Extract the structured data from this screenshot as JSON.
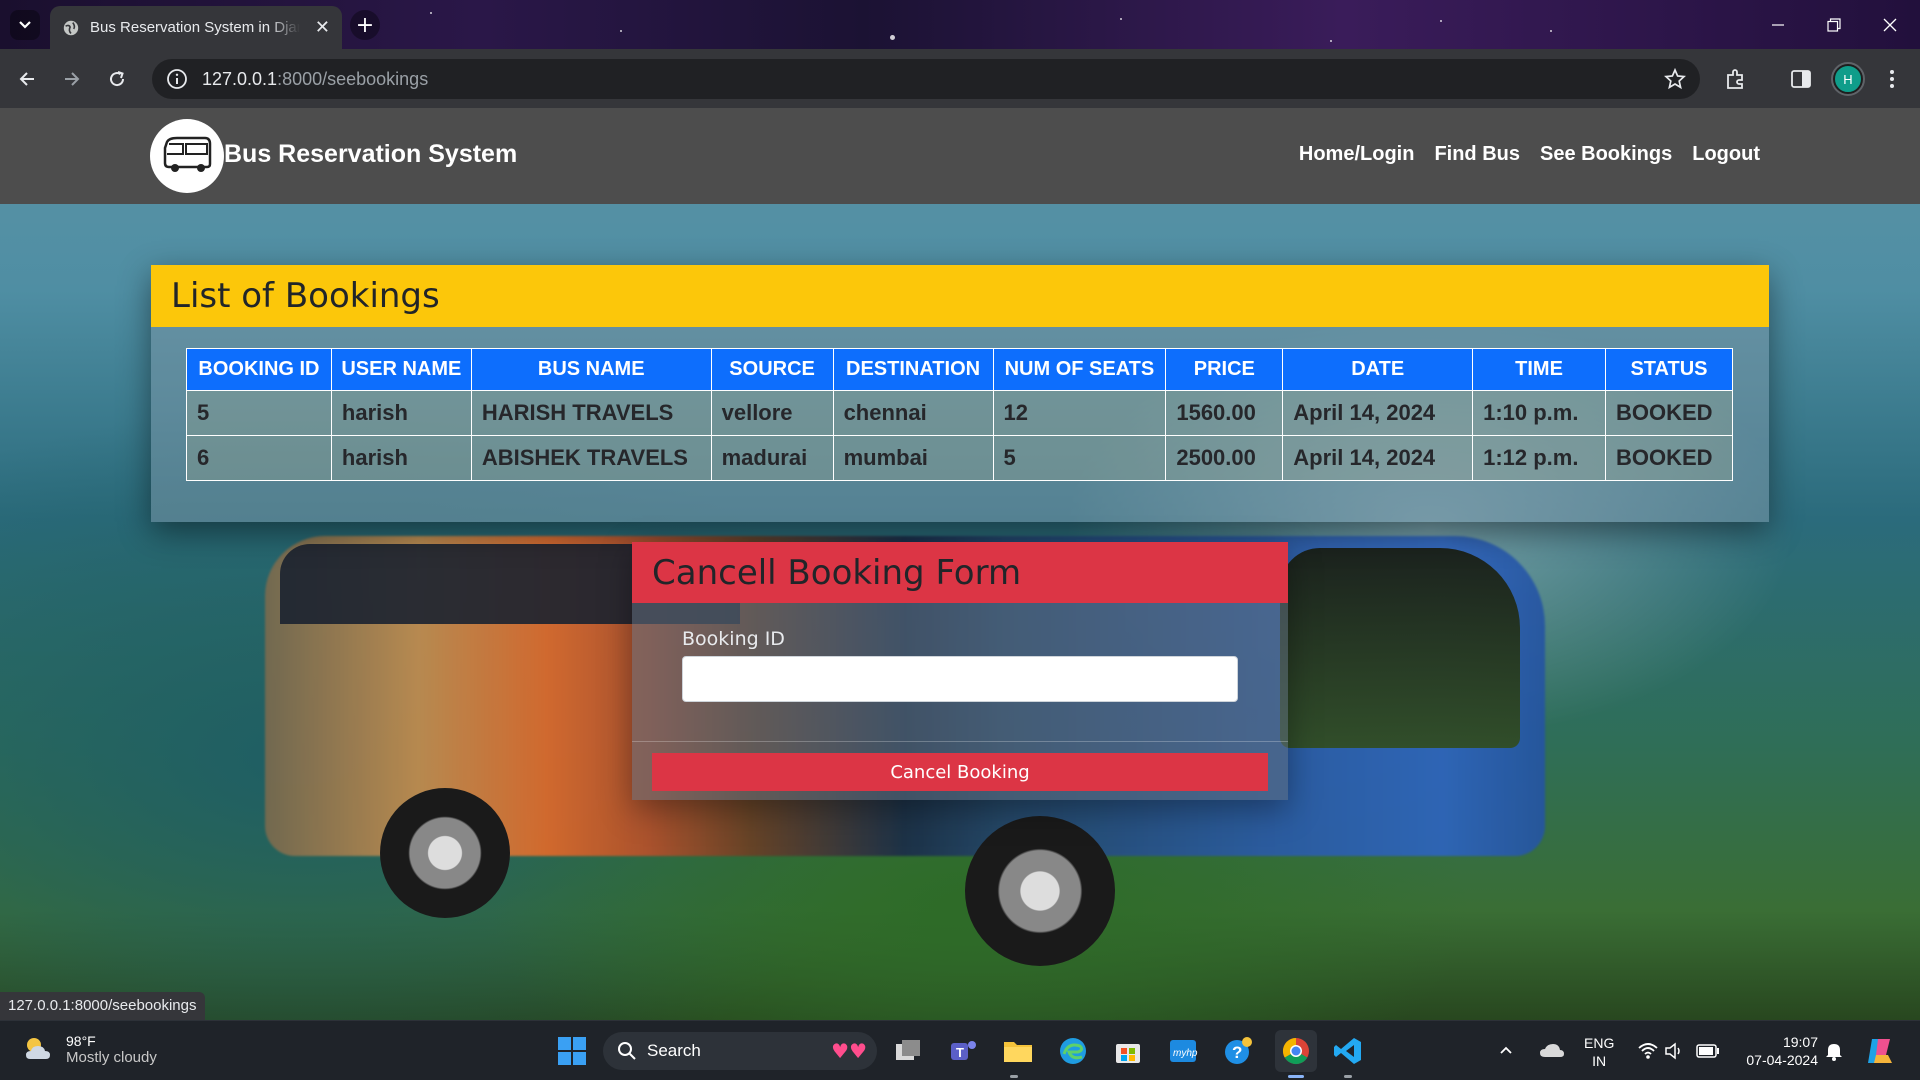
{
  "browser": {
    "tab_title": "Bus Reservation System in Django",
    "url_host": "127.0.0.1",
    "url_path": ":8000/seebookings",
    "profile_initial": "H"
  },
  "site": {
    "brand": "Bus Reservation System",
    "nav": [
      "Home/Login",
      "Find Bus",
      "See Bookings",
      "Logout"
    ]
  },
  "bookings": {
    "title": "List of Bookings",
    "columns": [
      "BOOKING ID",
      "USER NAME",
      "BUS NAME",
      "SOURCE",
      "DESTINATION",
      "NUM OF SEATS",
      "PRICE",
      "DATE",
      "TIME",
      "STATUS"
    ],
    "rows": [
      [
        "5",
        "harish",
        "HARISH TRAVELS",
        "vellore",
        "chennai",
        "12",
        "1560.00",
        "April 14, 2024",
        "1:10 p.m.",
        "BOOKED"
      ],
      [
        "6",
        "harish",
        "ABISHEK TRAVELS",
        "madurai",
        "mumbai",
        "5",
        "2500.00",
        "April 14, 2024",
        "1:12 p.m.",
        "BOOKED"
      ]
    ]
  },
  "cancel_form": {
    "title": "Cancell Booking Form",
    "field_label": "Booking ID",
    "field_value": "",
    "button_label": "Cancel Booking"
  },
  "status_bar_url": "127.0.0.1:8000/seebookings",
  "taskbar": {
    "weather_temp": "98°F",
    "weather_cond": "Mostly cloudy",
    "search_label": "Search",
    "lang_top": "ENG",
    "lang_bottom": "IN",
    "time": "19:07",
    "date": "07-04-2024"
  },
  "colors": {
    "header_yellow": "#fcc70a",
    "table_blue": "#0d6efd",
    "danger_red": "#dc3545"
  }
}
